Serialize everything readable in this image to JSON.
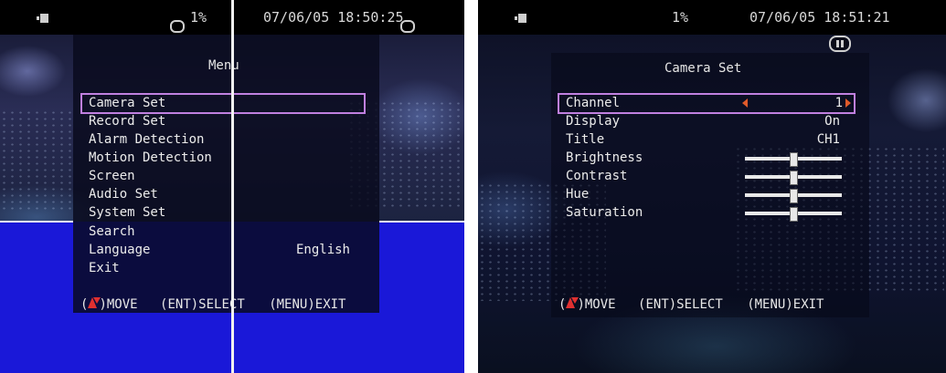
{
  "left_screen": {
    "status": {
      "percent": "1%",
      "datetime": "07/06/05 18:50:25"
    },
    "menu": {
      "title": "Menu",
      "items": [
        {
          "label": "Camera Set",
          "selected": true
        },
        {
          "label": "Record Set"
        },
        {
          "label": "Alarm Detection"
        },
        {
          "label": "Motion Detection"
        },
        {
          "label": "Screen"
        },
        {
          "label": "Audio Set"
        },
        {
          "label": "System Set"
        },
        {
          "label": "Search"
        },
        {
          "label": "Language",
          "value": "English"
        },
        {
          "label": "Exit"
        }
      ]
    },
    "footer": {
      "move": ")MOVE",
      "select": "(ENT)SELECT",
      "exit": "(MENU)EXIT"
    }
  },
  "right_screen": {
    "status": {
      "percent": "1%",
      "datetime": "07/06/05 18:51:21"
    },
    "menu": {
      "title": "Camera Set",
      "items": [
        {
          "label": "Channel",
          "value": "1",
          "selected": true
        },
        {
          "label": "Display",
          "value": "On"
        },
        {
          "label": "Title",
          "value": "CH1"
        },
        {
          "label": "Brightness",
          "slider": 0.5
        },
        {
          "label": "Contrast",
          "slider": 0.5
        },
        {
          "label": "Hue",
          "slider": 0.5
        },
        {
          "label": "Saturation",
          "slider": 0.5
        }
      ]
    },
    "footer": {
      "move": ")MOVE",
      "select": "(ENT)SELECT",
      "exit": "(MENU)EXIT"
    }
  },
  "colors": {
    "selection_border": "#c080e0",
    "arrow_accent": "#e05a2a",
    "blue_fill": "#1a18d8"
  }
}
